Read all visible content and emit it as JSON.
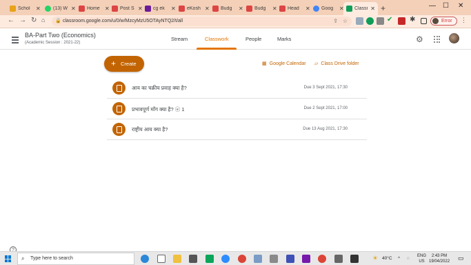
{
  "browser": {
    "tabs": [
      {
        "label": "Schol",
        "fav": "#e8a317"
      },
      {
        "label": "(13) W",
        "fav": "#25d366"
      },
      {
        "label": "Home",
        "fav": "#d44"
      },
      {
        "label": "Post S",
        "fav": "#d44"
      },
      {
        "label": "cg ek",
        "fav": "#6a1b9a"
      },
      {
        "label": "eKosh",
        "fav": "#d44"
      },
      {
        "label": "Budg",
        "fav": "#d44"
      },
      {
        "label": "Budg",
        "fav": "#d44"
      },
      {
        "label": "Head",
        "fav": "#d44"
      },
      {
        "label": "Goog",
        "fav": "#4285f4"
      },
      {
        "label": "Classr",
        "fav": "#0f9d58"
      }
    ],
    "url": "classroom.google.com/u/0/w/MzcyMzU5OTAyNTQ2/t/all",
    "profile_status": "Error"
  },
  "classroom": {
    "class_name": "BA-Part Two (Economics)",
    "session": "(Academic Session : 2021-22)",
    "tabs": [
      "Stream",
      "Classwork",
      "People",
      "Marks"
    ],
    "active_tab": "Classwork",
    "create_label": "Create",
    "calendar_label": "Google Calendar",
    "drive_label": "Class Drive folder",
    "assignments": [
      {
        "title": "आय का चक्रीय प्रवाह क्या है?",
        "due": "Due 3 Sept 2021, 17:30"
      },
      {
        "title": "प्रभावपूर्ण माँग क्या है?  ⓔ 1",
        "due": "Due 2 Sept 2021, 17:00"
      },
      {
        "title": "राष्ट्रीय आय क्या है?",
        "due": "Due 13 Aug 2021, 17:30"
      }
    ]
  },
  "taskbar": {
    "search_placeholder": "Type here to search",
    "temperature": "40°C",
    "language_line1": "ENG",
    "language_line2": "US",
    "time": "2:43 PM",
    "date": "19/04/2022"
  },
  "colors": {
    "accent": "#c26401",
    "tab_active": "#e37400"
  }
}
